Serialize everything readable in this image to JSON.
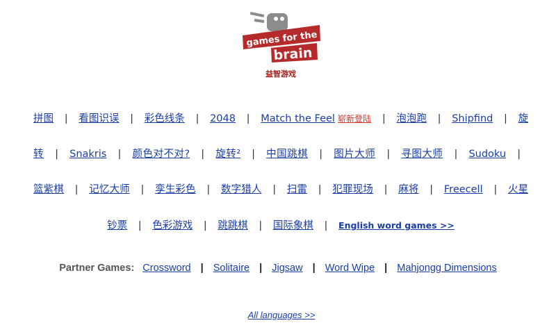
{
  "logo": {
    "line1": "games for the",
    "line2": "brain",
    "subtitle": "益智游戏",
    "colors": {
      "banner": "#b52a2a",
      "banner_dark": "#8a1e1e",
      "robot": "#8c8c8c"
    }
  },
  "games": [
    {
      "label": "拼图"
    },
    {
      "label": "看图识误"
    },
    {
      "label": "彩色线条"
    },
    {
      "label": "2048"
    },
    {
      "label": "Match the Feel",
      "badge": "崭新登陆"
    },
    {
      "label": "泡泡跑"
    },
    {
      "label": "Shipfind"
    },
    {
      "label": "旋转"
    },
    {
      "label": "Snakris"
    },
    {
      "label": "颜色对不对?"
    },
    {
      "label": "旋转²"
    },
    {
      "label": "中国跳棋"
    },
    {
      "label": "图片大师"
    },
    {
      "label": "寻图大师"
    },
    {
      "label": "Sudoku"
    },
    {
      "label": "篮紫棋"
    },
    {
      "label": "记忆大师"
    },
    {
      "label": "孪生彩色"
    },
    {
      "label": "数字猎人"
    },
    {
      "label": "扫雷"
    },
    {
      "label": "犯罪现场"
    },
    {
      "label": "麻将"
    },
    {
      "label": "Freecell"
    },
    {
      "label": "火星钞票"
    },
    {
      "label": "色彩游戏"
    },
    {
      "label": "跳跳棋"
    },
    {
      "label": "国际象棋"
    }
  ],
  "english_link": "English word games >>",
  "separator": "|",
  "partners": {
    "label": "Partner Games:",
    "items": [
      "Crossword",
      "Solitaire",
      "Jigsaw",
      "Word Wipe",
      "Mahjongg Dimensions"
    ]
  },
  "all_languages": "All languages >>",
  "colors": {
    "link": "#1a3ea8",
    "badge": "#d23b2a",
    "text": "#333333"
  }
}
